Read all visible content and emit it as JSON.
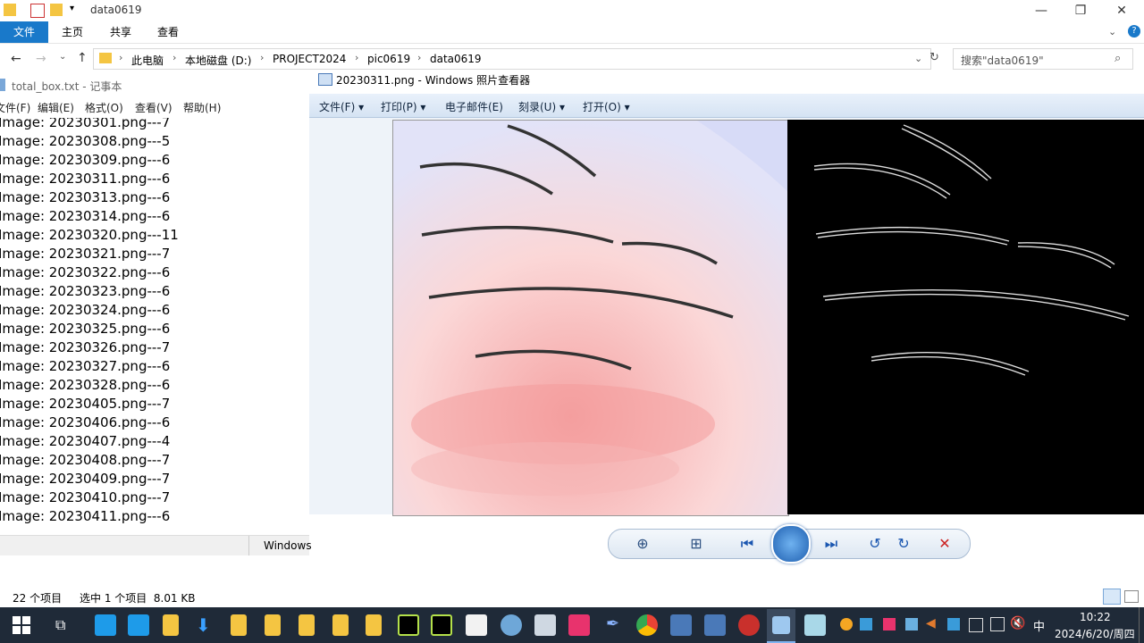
{
  "explorer": {
    "title": "data0619",
    "tabs": [
      "文件",
      "主页",
      "共享",
      "查看"
    ],
    "breadcrumb": [
      "此电脑",
      "本地磁盘 (D:)",
      "PROJECT2024",
      "pic0619",
      "data0619"
    ],
    "search_placeholder": "搜索\"data0619\"",
    "status_items": "22 个项目",
    "status_selected": "选中 1 个项目  8.01 KB"
  },
  "notepad": {
    "title": "total_box.txt - 记事本",
    "menu": [
      "文件(F)",
      "编辑(E)",
      "格式(O)",
      "查看(V)",
      "帮助(H)"
    ],
    "lines": [
      "Image: 20230301.png---7",
      "Image: 20230308.png---5",
      "Image: 20230309.png---6",
      "Image: 20230311.png---6",
      "Image: 20230313.png---6",
      "Image: 20230314.png---6",
      "Image: 20230320.png---11",
      "Image: 20230321.png---7",
      "Image: 20230322.png---6",
      "Image: 20230323.png---6",
      "Image: 20230324.png---6",
      "Image: 20230325.png---6",
      "Image: 20230326.png---7",
      "Image: 20230327.png---6",
      "Image: 20230328.png---6",
      "Image: 20230405.png---7",
      "Image: 20230406.png---6",
      "Image: 20230407.png---4",
      "Image: 20230408.png---7",
      "Image: 20230409.png---7",
      "Image: 20230410.png---7",
      "Image: 20230411.png---6"
    ],
    "status": "Windows"
  },
  "viewer": {
    "title": "20230311.png - Windows 照片查看器",
    "menu": [
      "文件(F)",
      "打印(P)",
      "电子邮件(E)",
      "刻录(U)",
      "打开(O)"
    ]
  },
  "taskbar": {
    "time": "10:22",
    "date": "2024/6/20/周四",
    "ime": "中"
  },
  "colors": {
    "accent": "#1979ca",
    "taskbar": "#1f2a38"
  }
}
